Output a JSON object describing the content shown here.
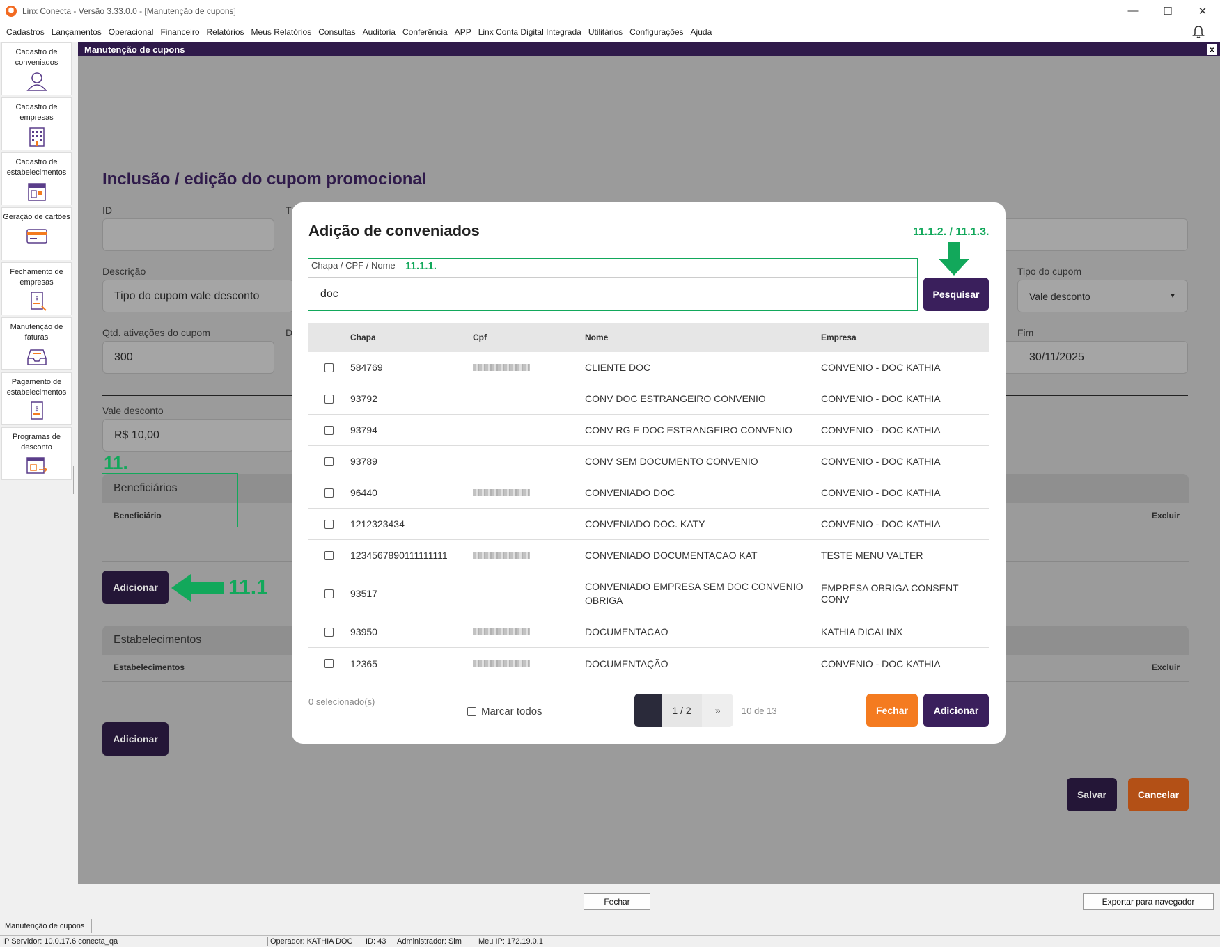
{
  "window": {
    "title": "Linx Conecta - Versão 3.33.0.0 - [Manutenção de cupons]"
  },
  "menu": [
    "Cadastros",
    "Lançamentos",
    "Operacional",
    "Financeiro",
    "Relatórios",
    "Meus Relatórios",
    "Consultas",
    "Auditoria",
    "Conferência",
    "APP",
    "Linx Conta Digital Integrada",
    "Utilitários",
    "Configurações",
    "Ajuda"
  ],
  "sidebar": [
    {
      "label": "Cadastro de conveniados",
      "icon": "person-icon"
    },
    {
      "label": "Cadastro de empresas",
      "icon": "building-icon"
    },
    {
      "label": "Cadastro de estabelecimentos",
      "icon": "store-icon"
    },
    {
      "label": "Geração de cartões",
      "icon": "card-icon"
    },
    {
      "label": "Fechamento de empresas",
      "icon": "invoice-close-icon"
    },
    {
      "label": "Manutenção de faturas",
      "icon": "inbox-icon"
    },
    {
      "label": "Pagamento de estabelecimentos",
      "icon": "payment-icon"
    },
    {
      "label": "Programas de desconto",
      "icon": "discount-program-icon"
    }
  ],
  "panel": {
    "title": "Manutenção de cupons",
    "close": "x"
  },
  "form": {
    "title": "Inclusão / edição do cupom promocional",
    "id_label": "ID",
    "t_label": "T",
    "descricao_label": "Descrição",
    "descricao_value": "Tipo do cupom vale desconto",
    "tipo_label": "Tipo do cupom",
    "tipo_value": "Vale desconto",
    "qtd_label": "Qtd. ativações do cupom",
    "qtd_value": "300",
    "d_label": "D",
    "fim_label": "Fim",
    "fim_value": "30/11/2025",
    "vale_label": "Vale desconto",
    "vale_value": "R$ 10,00",
    "beneficiarios_title": "Beneficiários",
    "beneficiario_col": "Beneficiário",
    "excluir_col": "Excluir",
    "adicionar": "Adicionar",
    "estabelecimentos_title": "Estabelecimentos",
    "estabelecimentos_col": "Estabelecimentos",
    "excluir_col2": "Excluir",
    "adicionar2": "Adicionar",
    "salvar": "Salvar",
    "cancelar": "Cancelar"
  },
  "annotations": {
    "a11": "11.",
    "a111": "11.1",
    "a1111": "11.1.1.",
    "a1112": "11.1.2. / 11.1.3."
  },
  "modal": {
    "title": "Adição de conveniados",
    "search_label": "Chapa / CPF / Nome",
    "search_value": "doc",
    "search_button": "Pesquisar",
    "columns": {
      "chapa": "Chapa",
      "cpf": "Cpf",
      "nome": "Nome",
      "empresa": "Empresa"
    },
    "rows": [
      {
        "chapa": "584769",
        "cpf": true,
        "nome": "CLIENTE DOC",
        "empresa": "CONVENIO - DOC KATHIA"
      },
      {
        "chapa": "93792",
        "cpf": false,
        "nome": "CONV DOC ESTRANGEIRO CONVENIO",
        "empresa": "CONVENIO - DOC KATHIA"
      },
      {
        "chapa": "93794",
        "cpf": false,
        "nome": "CONV RG E DOC ESTRANGEIRO CONVENIO",
        "empresa": "CONVENIO - DOC KATHIA"
      },
      {
        "chapa": "93789",
        "cpf": false,
        "nome": "CONV SEM DOCUMENTO CONVENIO",
        "empresa": "CONVENIO - DOC KATHIA"
      },
      {
        "chapa": "96440",
        "cpf": true,
        "nome": "CONVENIADO DOC",
        "empresa": "CONVENIO - DOC KATHIA"
      },
      {
        "chapa": "1212323434",
        "cpf": false,
        "nome": "CONVENIADO DOC. KATY",
        "empresa": "CONVENIO - DOC KATHIA"
      },
      {
        "chapa": "1234567890111111111",
        "cpf": true,
        "nome": "CONVENIADO DOCUMENTACAO KAT",
        "empresa": "TESTE MENU VALTER"
      },
      {
        "chapa": "93517",
        "cpf": false,
        "nome": "CONVENIADO EMPRESA SEM DOC CONVENIO OBRIGA",
        "empresa": "EMPRESA OBRIGA CONSENT CONV"
      },
      {
        "chapa": "93950",
        "cpf": true,
        "nome": "DOCUMENTACAO",
        "empresa": "KATHIA DICALINX"
      },
      {
        "chapa": "12365",
        "cpf": true,
        "nome": "DOCUMENTAÇÃO",
        "empresa": "CONVENIO - DOC KATHIA"
      }
    ],
    "selected_count": "0 selecionado(s)",
    "select_all": "Marcar todos",
    "page": "1 / 2",
    "next": "»",
    "count": "10 de 13",
    "close_button": "Fechar",
    "add_button": "Adicionar"
  },
  "bottom": {
    "fechar": "Fechar",
    "exportar": "Exportar para navegador"
  },
  "tab": "Manutenção de cupons",
  "status": {
    "servidor": "IP Servidor: 10.0.17.6 conecta_qa",
    "operador": "Operador: KATHIA DOC",
    "id": "ID: 43",
    "admin": "Administrador: Sim",
    "ip": "Meu IP: 172.19.0.1"
  },
  "colors": {
    "brand_purple": "#2f1a4a",
    "accent_orange": "#f47b20",
    "annotation_green": "#12a85b"
  }
}
